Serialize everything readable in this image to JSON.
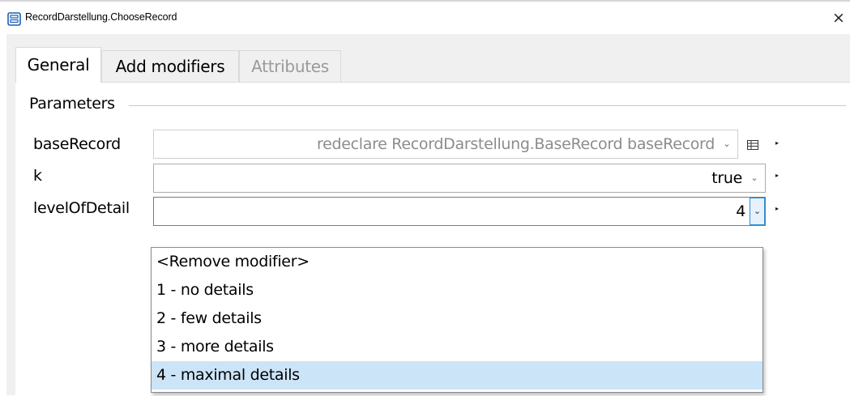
{
  "window": {
    "title": "RecordDarstellung.ChooseRecord",
    "close_glyph": "×"
  },
  "tabs": [
    {
      "label": "General",
      "state": "active"
    },
    {
      "label": "Add modifiers",
      "state": "normal"
    },
    {
      "label": "Attributes",
      "state": "disabled"
    }
  ],
  "parameters": {
    "group_label": "Parameters",
    "rows": [
      {
        "label": "baseRecord",
        "value": "redeclare RecordDarstellung.BaseRecord baseRecord",
        "enabled": false
      },
      {
        "label": "k",
        "value": "true",
        "enabled": true
      },
      {
        "label": "levelOfDetail",
        "value": "4",
        "enabled": true,
        "dropdown_open": true
      }
    ]
  },
  "dropdown": {
    "options": [
      "<Remove modifier>",
      "1 - no details",
      "2 - few details",
      "3 - more details",
      "4 - maximal details"
    ],
    "selected": "4 - maximal details"
  },
  "colors": {
    "dialog_bg": "#f0f0f0",
    "selected_option": "#cce4f7",
    "focus_border": "#2f8fd8",
    "disabled_text": "#8c8c8c"
  },
  "icons": {
    "app": "record-icon",
    "close": "close-icon",
    "table": "table-icon",
    "caret": "chevron-down-icon",
    "submenu": "triangle-right-icon"
  }
}
